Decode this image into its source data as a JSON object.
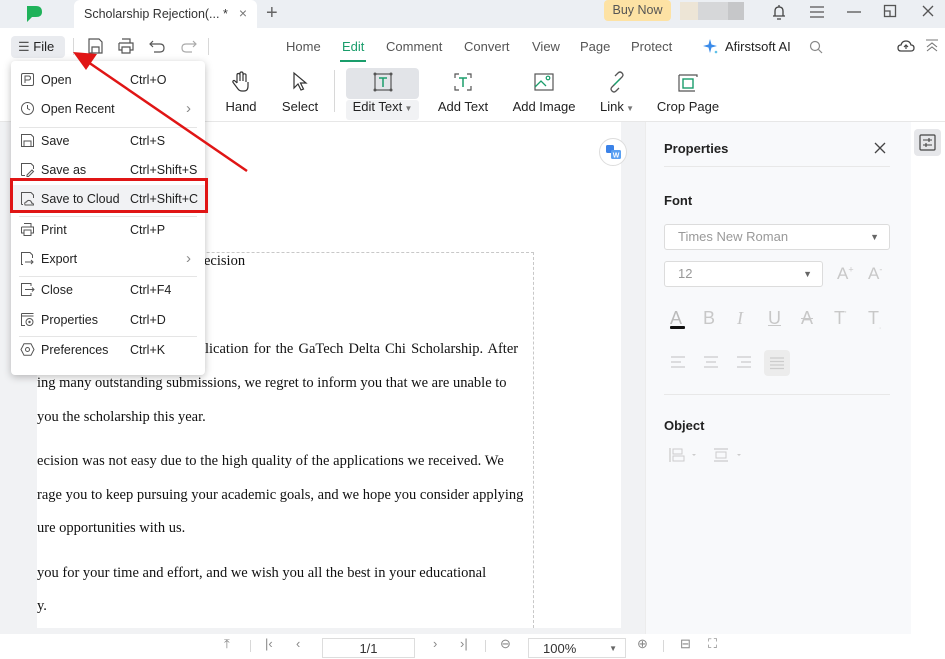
{
  "titlebar": {
    "tab_title": "Scholarship Rejection(... *",
    "close_tab": "×",
    "new_tab": "+",
    "buy_now": "Buy Now"
  },
  "menubar": {
    "file_label": "File",
    "tabs": [
      "Home",
      "Edit",
      "Comment",
      "Convert",
      "View",
      "Page",
      "Protect"
    ],
    "active_tab": "Edit",
    "ai_label": "Afirstsoft AI"
  },
  "tools": [
    {
      "label": "Hand",
      "icon": "hand-icon"
    },
    {
      "label": "Select",
      "icon": "cursor-icon"
    },
    {
      "label": "Edit Text",
      "icon": "edit-text-icon",
      "dropdown": true,
      "selected": true
    },
    {
      "label": "Add Text",
      "icon": "add-text-icon"
    },
    {
      "label": "Add Image",
      "icon": "add-image-icon"
    },
    {
      "label": "Link",
      "icon": "link-icon",
      "dropdown": true
    },
    {
      "label": "Crop Page",
      "icon": "crop-icon"
    }
  ],
  "file_menu": {
    "items": [
      {
        "label": "Open",
        "shortcut": "Ctrl+O",
        "icon": "open-file-icon"
      },
      {
        "label": "Open Recent",
        "shortcut": "",
        "icon": "clock-icon",
        "submenu": true
      },
      {
        "label": "Save",
        "shortcut": "Ctrl+S",
        "icon": "save-icon"
      },
      {
        "label": "Save as",
        "shortcut": "Ctrl+Shift+S",
        "icon": "save-as-icon"
      },
      {
        "label": "Save to Cloud",
        "shortcut": "Ctrl+Shift+C",
        "icon": "save-cloud-icon",
        "highlighted": true
      },
      {
        "label": "Print",
        "shortcut": "Ctrl+P",
        "icon": "print-icon"
      },
      {
        "label": "Export",
        "shortcut": "",
        "icon": "export-icon",
        "submenu": true
      },
      {
        "label": "Close",
        "shortcut": "Ctrl+F4",
        "icon": "close-file-icon"
      },
      {
        "label": "Properties",
        "shortcut": "Ctrl+D",
        "icon": "properties-icon"
      },
      {
        "label": "Preferences",
        "shortcut": "Ctrl+K",
        "icon": "preferences-icon"
      }
    ]
  },
  "document": {
    "lines": [
      "ecision",
      "lication  for  the  GaTech Delta Chi Scholarship.  After",
      "ing many outstanding  submissions, we regret to inform you that we are  unable to",
      "you   the scholarship  this year.",
      "ecision was not easy due to the high quality of the applications we received. We",
      "rage you to keep pursuing your academic goals, and we hope you consider applying",
      "ure opportunities with us.",
      " you  for  your  time  and  effort,  and  we  wish  you  all  the  best  in  your  educational",
      "y."
    ]
  },
  "properties": {
    "title": "Properties",
    "font_heading": "Font",
    "font_family": "Times New Roman",
    "font_size": "12",
    "object_heading": "Object"
  },
  "statusbar": {
    "page": "1/1",
    "zoom": "100%"
  },
  "colors": {
    "accent": "#1a9d6b",
    "annotation_red": "#e01515",
    "buy_now_bg": "#fde2a4"
  }
}
